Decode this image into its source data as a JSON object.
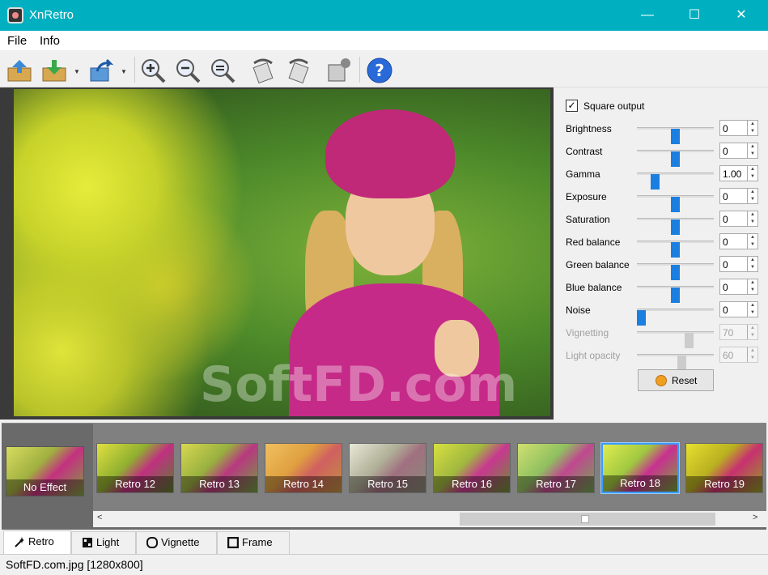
{
  "window": {
    "title": "XnRetro",
    "minimize": "—",
    "maximize": "☐",
    "close": "✕"
  },
  "menu": {
    "file": "File",
    "info": "Info"
  },
  "toolbar": {
    "icons": [
      "open-icon",
      "save-icon",
      "export-icon",
      "zoom-in-icon",
      "zoom-out-icon",
      "zoom-fit-icon",
      "rotate-left-icon",
      "rotate-right-icon",
      "crop-icon",
      "help-icon"
    ]
  },
  "preview": {
    "watermark": "SoftFD.com"
  },
  "settings": {
    "square_output_label": "Square output",
    "square_output_checked": true,
    "rows": [
      {
        "label": "Brightness",
        "value": "0",
        "level": 0.5,
        "enabled": true
      },
      {
        "label": "Contrast",
        "value": "0",
        "level": 0.5,
        "enabled": true
      },
      {
        "label": "Gamma",
        "value": "1.00",
        "level": 0.2,
        "enabled": true
      },
      {
        "label": "Exposure",
        "value": "0",
        "level": 0.5,
        "enabled": true
      },
      {
        "label": "Saturation",
        "value": "0",
        "level": 0.5,
        "enabled": true
      },
      {
        "label": "Red balance",
        "value": "0",
        "level": 0.5,
        "enabled": true
      },
      {
        "label": "Green balance",
        "value": "0",
        "level": 0.5,
        "enabled": true
      },
      {
        "label": "Blue balance",
        "value": "0",
        "level": 0.5,
        "enabled": true
      },
      {
        "label": "Noise",
        "value": "0",
        "level": 0.0,
        "enabled": true
      },
      {
        "label": "Vignetting",
        "value": "70",
        "level": 0.7,
        "enabled": false
      },
      {
        "label": "Light opacity",
        "value": "60",
        "level": 0.6,
        "enabled": false
      }
    ],
    "reset_label": "Reset"
  },
  "effects": {
    "no_effect": "No Effect",
    "items": [
      "Retro 12",
      "Retro 13",
      "Retro 14",
      "Retro 15",
      "Retro 16",
      "Retro 17",
      "Retro 18",
      "Retro 19"
    ],
    "selected": "Retro 18"
  },
  "tabs": [
    "Retro",
    "Light",
    "Vignette",
    "Frame"
  ],
  "status": {
    "file": "SoftFD.com.jpg [1280x800]"
  }
}
